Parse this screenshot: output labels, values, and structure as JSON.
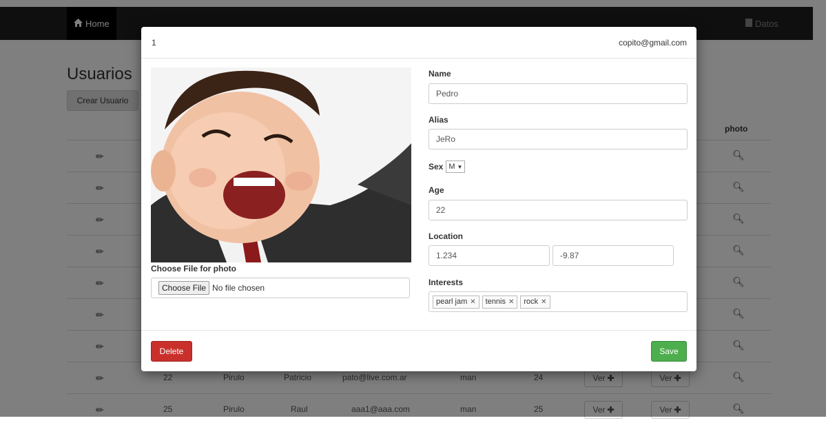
{
  "navbar": {
    "home_label": "Home",
    "home_icon": "home-icon",
    "datos_label": "Datos",
    "datos_icon": "book-icon"
  },
  "page": {
    "title": "Usuarios",
    "create_button": "Crear Usuario",
    "photo_header": "photo"
  },
  "table": {
    "visible_rows": [
      {
        "id": "22",
        "last": "Pirulo",
        "first": "Patricio",
        "email": "pato@live.com.ar",
        "sex": "man",
        "age": "24",
        "ver1": "Ver",
        "ver2": "Ver"
      },
      {
        "id": "25",
        "last": "Pirulo",
        "first": "Raul",
        "email": "aaa1@aaa.com",
        "sex": "man",
        "age": "25",
        "ver1": "Ver",
        "ver2": "Ver"
      }
    ]
  },
  "modal": {
    "id": "1",
    "email": "copito@gmail.com",
    "photo_label": "Choose File for photo",
    "file_button": "Choose File",
    "file_status": "No file chosen",
    "name_label": "Name",
    "name_value": "Pedro",
    "alias_label": "Alias",
    "alias_value": "JeRo",
    "sex_label": "Sex",
    "sex_value": "M",
    "age_label": "Age",
    "age_value": "22",
    "location_label": "Location",
    "location_lat": "1.234",
    "location_lng": "-9.87",
    "interests_label": "Interests",
    "interests": [
      "pearl jam",
      "tennis",
      "rock"
    ],
    "delete_button": "Delete",
    "save_button": "Save"
  },
  "colors": {
    "navbar": "#1f1f1f",
    "delete": "#c9302c",
    "save": "#4cae4c"
  }
}
